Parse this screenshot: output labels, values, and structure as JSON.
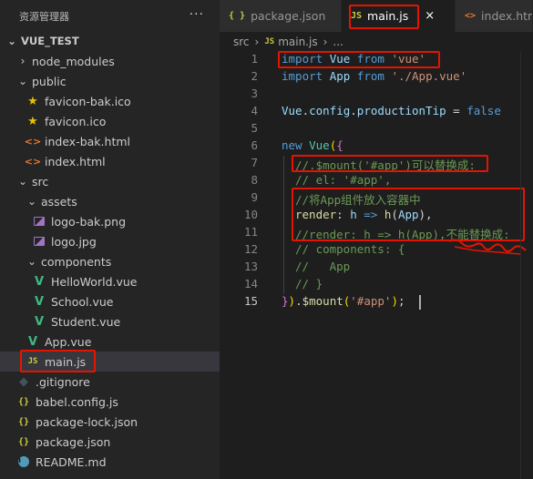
{
  "sidebar": {
    "title": "资源管理器",
    "more": "···",
    "root": "VUE_TEST",
    "items": [
      {
        "label": "node_modules"
      },
      {
        "label": "public"
      },
      {
        "label": "favicon-bak.ico"
      },
      {
        "label": "favicon.ico"
      },
      {
        "label": "index-bak.html"
      },
      {
        "label": "index.html"
      },
      {
        "label": "src"
      },
      {
        "label": "assets"
      },
      {
        "label": "logo-bak.png"
      },
      {
        "label": "logo.jpg"
      },
      {
        "label": "components"
      },
      {
        "label": "HelloWorld.vue"
      },
      {
        "label": "School.vue"
      },
      {
        "label": "Student.vue"
      },
      {
        "label": "App.vue"
      },
      {
        "label": "main.js"
      },
      {
        "label": ".gitignore"
      },
      {
        "label": "babel.config.js"
      },
      {
        "label": "package-lock.json"
      },
      {
        "label": "package.json"
      },
      {
        "label": "README.md"
      }
    ]
  },
  "tabs": [
    {
      "icon": "{ }",
      "label": "package.json"
    },
    {
      "icon": "JS",
      "label": "main.js",
      "close": "×"
    },
    {
      "icon": "<>",
      "label": "index.html"
    }
  ],
  "breadcrumb": {
    "folder": "src",
    "file_icon": "JS",
    "file": "main.js",
    "tail": "..."
  },
  "editor": {
    "line_numbers": [
      "1",
      "2",
      "3",
      "4",
      "5",
      "6",
      "7",
      "8",
      "9",
      "10",
      "11",
      "12",
      "13",
      "14",
      "15"
    ],
    "line1": {
      "a": "import",
      "b": "Vue",
      "c": "from",
      "d": "'vue'"
    },
    "line2": {
      "a": "import",
      "b": "App",
      "c": "from",
      "d": "'./App.vue'"
    },
    "line4": {
      "a": "Vue",
      "b": "config",
      "c": "productionTip",
      "d": "false"
    },
    "line6": {
      "a": "new",
      "b": "Vue"
    },
    "line7": "//.$mount('#app')可以替换成:",
    "line8": "// el: '#app',",
    "line9": "//将App组件放入容器中",
    "line10": {
      "a": "render",
      "b": "h",
      "c": "h",
      "d": "App"
    },
    "line11": "//render: h => h(App),不能替换成:",
    "line12": "// components: {",
    "line13": "//   App",
    "line14": "// }",
    "line15": {
      "a": "$mount",
      "b": "'#app'"
    }
  }
}
